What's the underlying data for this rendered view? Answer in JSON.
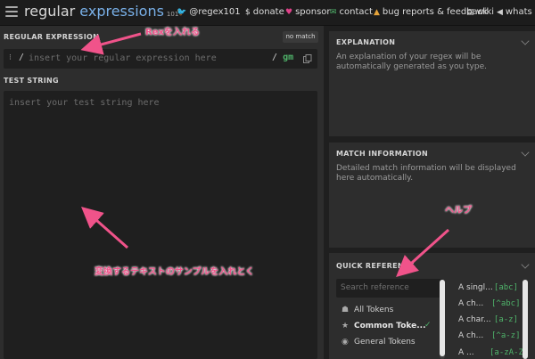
{
  "header": {
    "logo_part1": "regular ",
    "logo_part2": "expressions",
    "logo_version": "101",
    "nav": [
      {
        "label": "@regex101",
        "icon": "twitter-bird-icon",
        "color": "#58a6e0"
      },
      {
        "label": "donate",
        "icon": "dollar-icon",
        "color": "#e2e2e2"
      },
      {
        "label": "sponsor",
        "icon": "heart-icon",
        "color": "#e0428a"
      },
      {
        "label": "contact",
        "icon": "envelope-icon",
        "color": "#4fb36a"
      },
      {
        "label": "bug reports & feedback",
        "icon": "warning-icon",
        "color": "#e5a33a"
      },
      {
        "label": "wiki",
        "icon": "book-icon",
        "color": "#cfcfcf"
      },
      {
        "label": "whats new?",
        "icon": "megaphone-icon",
        "color": "#cfcfcf"
      }
    ]
  },
  "regex": {
    "label": "REGULAR EXPRESSION",
    "badge": "no match",
    "handle": "⁝",
    "delimiter": "/",
    "placeholder": "insert your regular expression here",
    "closing_delimiter": "/",
    "flags": "gm"
  },
  "test": {
    "label": "TEST STRING",
    "placeholder": "insert your test string here"
  },
  "explanation": {
    "title": "EXPLANATION",
    "text": "An explanation of your regex will be automatically generated as you type."
  },
  "match_info": {
    "title": "MATCH INFORMATION",
    "text": "Detailed match information will be displayed here automatically."
  },
  "quick_ref": {
    "title": "QUICK REFERENCE",
    "search_placeholder": "Search reference",
    "categories": [
      {
        "label": "All Tokens",
        "icon": "folder-stack-icon"
      },
      {
        "label": "Common Toke...",
        "icon": "star-icon",
        "active": true
      },
      {
        "label": "General Tokens",
        "icon": "circle-target-icon"
      }
    ],
    "checkmark": "✓",
    "items": [
      {
        "label": "A singl...",
        "code": "[abc]"
      },
      {
        "label": "A ch...",
        "code": "[^abc]"
      },
      {
        "label": "A char...",
        "code": "[a-z]"
      },
      {
        "label": "A ch...",
        "code": "[^a-z]"
      },
      {
        "label": "A ...",
        "code": "[a-zA-Z]"
      }
    ]
  },
  "annotations": {
    "regex_note": "Rexを入れる",
    "help_note": "ヘルプ",
    "sample_note": "変換するテキストのサンプルを入れとく",
    "color": "#f0538a"
  }
}
